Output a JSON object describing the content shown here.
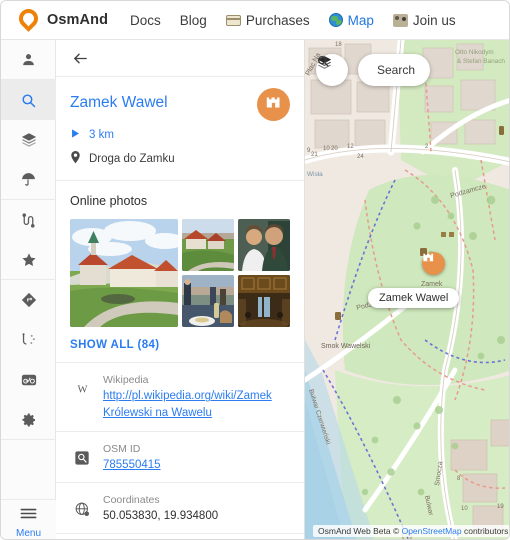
{
  "topbar": {
    "brand": "OsmAnd",
    "links": [
      {
        "label": "Docs",
        "icon": ""
      },
      {
        "label": "Blog",
        "icon": ""
      },
      {
        "label": "Purchases",
        "icon": "card-icon"
      },
      {
        "label": "Map",
        "icon": "globe-icon",
        "active": true
      },
      {
        "label": "Join us",
        "icon": "people-icon"
      }
    ]
  },
  "rail": {
    "items": [
      {
        "name": "profile",
        "icon": "person-icon"
      },
      {
        "name": "search",
        "icon": "search-icon",
        "active": true
      },
      {
        "name": "layers",
        "icon": "layers-icon"
      },
      {
        "name": "weather",
        "icon": "umbrella-icon"
      },
      {
        "name": "tracks",
        "icon": "track-icon"
      },
      {
        "name": "favorites",
        "icon": "star-icon"
      },
      {
        "name": "navigation",
        "icon": "navigation-icon"
      },
      {
        "name": "plugins",
        "icon": "plugins-icon"
      },
      {
        "name": "cycling",
        "icon": "bicycle-icon"
      },
      {
        "name": "settings",
        "icon": "gear-icon"
      }
    ],
    "menu_label": "Menu"
  },
  "panel": {
    "back_label": "Back",
    "title": "Zamek Wawel",
    "badge_icon": "castle-icon",
    "distance": "3 km",
    "address": "Droga do Zamku",
    "photos": {
      "heading": "Online photos",
      "show_all": "SHOW ALL (84)",
      "items": [
        {
          "alt": "Wawel Castle courtyard with green lawn and red roofs"
        },
        {
          "alt": "Aerial view of Wawel Castle and Krakow skyline"
        },
        {
          "alt": "Two people in conversation indoors"
        },
        {
          "alt": "Outdoor dining table with drinks near the castle"
        },
        {
          "alt": "Ornate interior hall with coffered ceiling"
        }
      ]
    },
    "details": [
      {
        "icon": "wikipedia-icon",
        "label": "Wikipedia",
        "value": "http://pl.wikipedia.org/wiki/Zamek Królewski na Wawelu",
        "is_link": true
      },
      {
        "icon": "osm-id-icon",
        "label": "OSM ID",
        "value": "785550415",
        "is_link": true
      },
      {
        "icon": "coordinates-icon",
        "label": "Coordinates",
        "value": "50.053830, 19.934800",
        "is_link": false
      }
    ]
  },
  "map": {
    "layers_label": "Layers",
    "search_label": "Search",
    "marker_label": "Zamek Wawel",
    "marker_icon": "castle-icon",
    "poi_label": "Zamek Wawel",
    "attribution_prefix": "OsmAnd Web Beta © ",
    "attribution_link": "OpenStreetMap",
    "attribution_suffix": " contributors",
    "street_labels": [
      "Plac Na",
      "Podzamcze",
      "Podzamcze",
      "Otto Nikodym",
      "& Stefan Banach",
      "Smok Wawelski",
      "Bulwar Czerwieński",
      "Bulwar",
      "Smocza",
      "Wisła"
    ],
    "house_numbers": [
      "18",
      "20",
      "21",
      "24",
      "12",
      "10",
      "9",
      "2",
      "8",
      "19"
    ]
  },
  "colors": {
    "brand_orange": "#ee8208",
    "accent_blue": "#2b7cf0",
    "badge_orange": "#e8914a",
    "map_green": "#cfe8bd",
    "map_water": "#a9d2e6"
  }
}
